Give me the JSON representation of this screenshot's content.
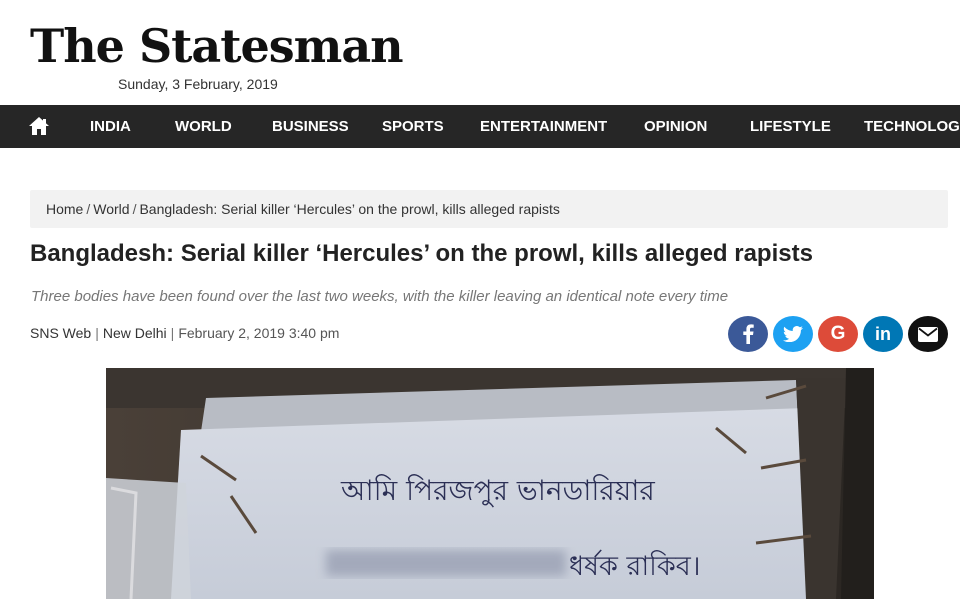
{
  "site": {
    "logo_text": "The Statesman",
    "date": "Sunday, 3 February, 2019"
  },
  "nav": {
    "home_icon": "home-icon",
    "items": [
      {
        "label": "INDIA"
      },
      {
        "label": "WORLD"
      },
      {
        "label": "BUSINESS"
      },
      {
        "label": "SPORTS"
      },
      {
        "label": "ENTERTAINMENT"
      },
      {
        "label": "OPINION"
      },
      {
        "label": "LIFESTYLE"
      },
      {
        "label": "TECHNOLOGY"
      }
    ]
  },
  "breadcrumb": {
    "items": [
      "Home",
      "World",
      "Bangladesh: Serial killer ‘Hercules’ on the prowl, kills alleged rapists"
    ],
    "separator": "/"
  },
  "article": {
    "headline": "Bangladesh: Serial killer ‘Hercules’ on the prowl, kills alleged rapists",
    "summary": "Three bodies have been found over the last two weeks, with the killer leaving an identical note every time",
    "author": "SNS Web",
    "location": "New Delhi",
    "published": "February 2, 2019 3:40 pm",
    "byline_separator": "|"
  },
  "share": {
    "buttons": [
      {
        "name": "facebook",
        "icon": "facebook-icon",
        "color": "#3b5998"
      },
      {
        "name": "twitter",
        "icon": "twitter-icon",
        "color": "#1da1f2"
      },
      {
        "name": "google",
        "icon": "google-plus-icon",
        "color": "#dd4b39",
        "label": "G"
      },
      {
        "name": "linkedin",
        "icon": "linkedin-icon",
        "color": "#0077b5",
        "label": "in"
      },
      {
        "name": "email",
        "icon": "email-icon",
        "color": "#111111"
      }
    ]
  },
  "hero_image": {
    "note_line_1": "আমি পিরজপুর ভানডারিয়ার",
    "note_line_2": "ধর্ষক রাকিব।"
  },
  "colors": {
    "nav_background": "#262626",
    "breadcrumb_background": "#f2f2f2",
    "summary_text": "#777777"
  }
}
